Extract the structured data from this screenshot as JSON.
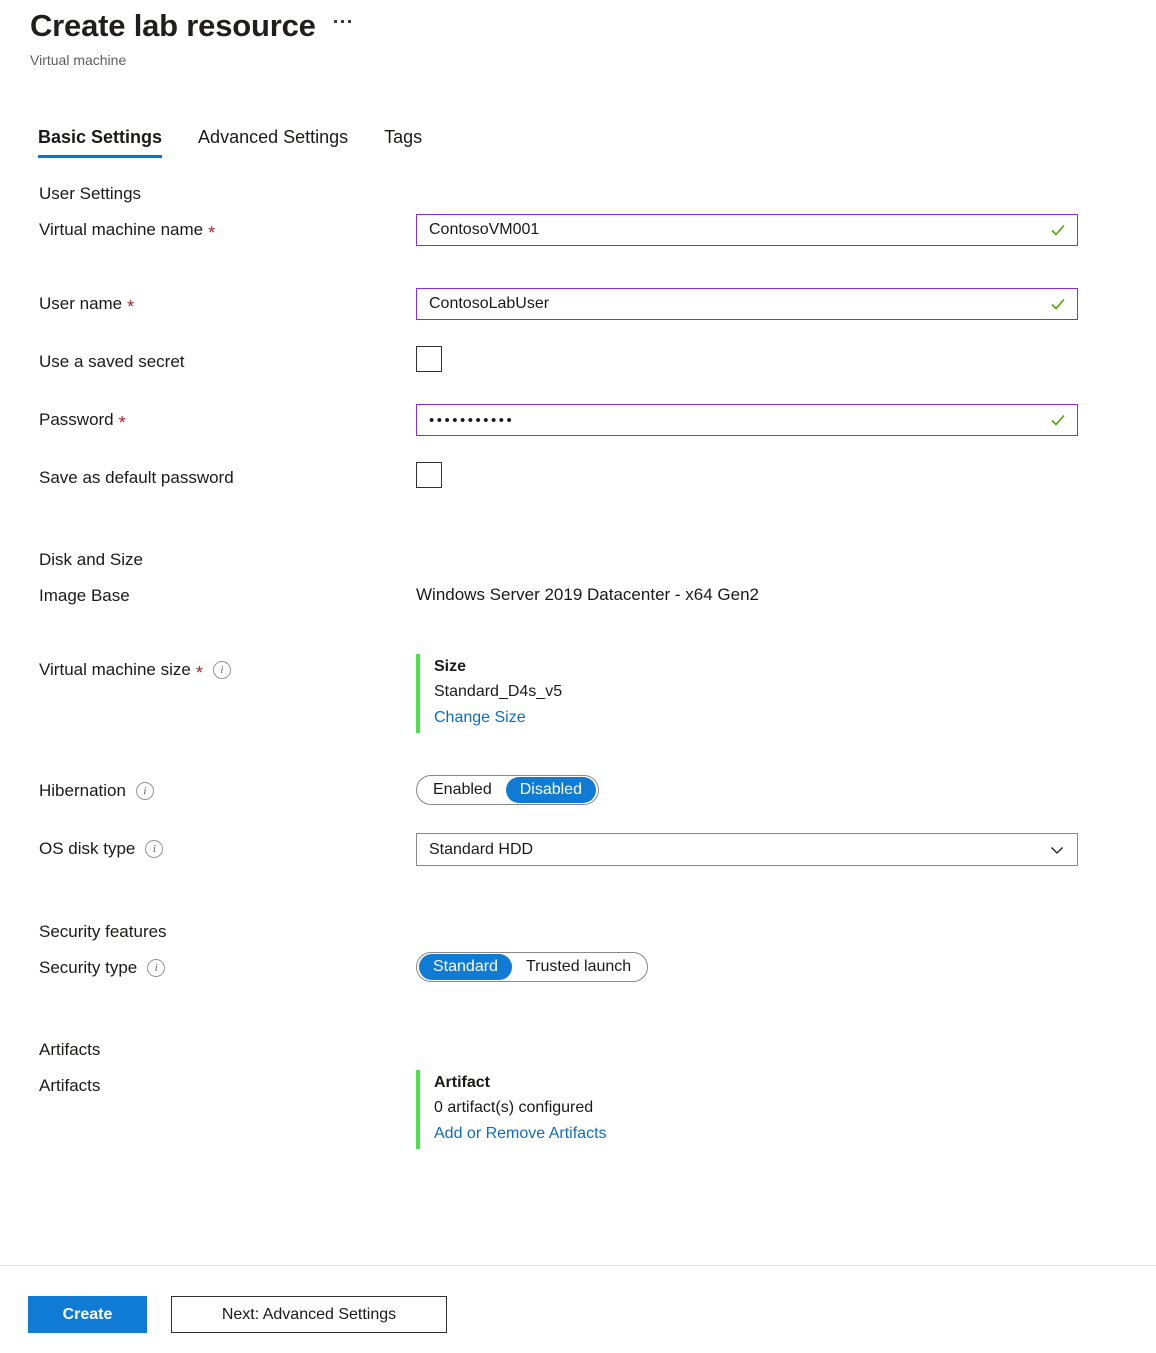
{
  "header": {
    "title": "Create lab resource",
    "subtitle": "Virtual machine",
    "more_label": "More options"
  },
  "tabs": [
    {
      "label": "Basic Settings",
      "active": true
    },
    {
      "label": "Advanced Settings",
      "active": false
    },
    {
      "label": "Tags",
      "active": false
    }
  ],
  "sections": {
    "user_settings": {
      "heading": "User Settings",
      "vm_name": {
        "label": "Virtual machine name",
        "required": "*",
        "value": "ContosoVM001",
        "valid": true
      },
      "user_name": {
        "label": "User name",
        "required": "*",
        "value": "ContosoLabUser",
        "valid": true
      },
      "use_saved_secret": {
        "label": "Use a saved secret",
        "checked": false
      },
      "password": {
        "label": "Password",
        "required": "*",
        "value": "•••••••••••",
        "valid": true
      },
      "save_default_password": {
        "label": "Save as default password",
        "checked": false
      }
    },
    "disk_and_size": {
      "heading": "Disk and Size",
      "image_base": {
        "label": "Image Base",
        "value": "Windows Server 2019 Datacenter - x64 Gen2"
      },
      "vm_size": {
        "label": "Virtual machine size",
        "required": "*",
        "card_title": "Size",
        "card_value": "Standard_D4s_v5",
        "link": "Change Size"
      },
      "hibernation": {
        "label": "Hibernation",
        "options": [
          "Enabled",
          "Disabled"
        ],
        "selected": "Disabled"
      },
      "os_disk_type": {
        "label": "OS disk type",
        "value": "Standard HDD"
      }
    },
    "security_features": {
      "heading": "Security features",
      "security_type": {
        "label": "Security type",
        "options": [
          "Standard",
          "Trusted launch"
        ],
        "selected": "Standard"
      }
    },
    "artifacts": {
      "heading": "Artifacts",
      "artifacts_row": {
        "label": "Artifacts",
        "card_title": "Artifact",
        "card_value": "0 artifact(s) configured",
        "link": "Add or Remove Artifacts"
      }
    }
  },
  "footer": {
    "create_label": "Create",
    "next_label": "Next: Advanced Settings"
  },
  "colors": {
    "accent_blue": "#0f7bd4",
    "tab_underline": "#0078d4",
    "valid_border": "#8a2be2",
    "valid_check": "#4da400",
    "required_asterisk": "#a4262c",
    "card_accent_green": "#4ce04c",
    "link_blue": "#0f6cbd"
  }
}
